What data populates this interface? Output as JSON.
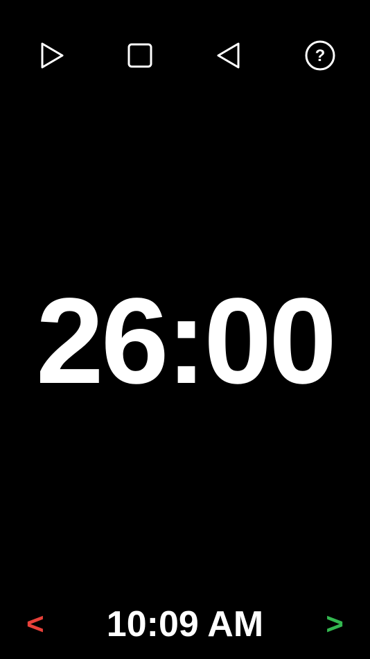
{
  "colors": {
    "background": "#000000",
    "foreground": "#ffffff",
    "prev_arrow": "#e8413a",
    "next_arrow": "#33b850"
  },
  "toolbar": {
    "play_icon": "play-icon",
    "stop_icon": "stop-icon",
    "back_icon": "back-triangle-icon",
    "help_icon": "help-icon",
    "help_glyph": "?"
  },
  "timer": {
    "display": "26:00"
  },
  "footer": {
    "prev_label": "<",
    "clock": "10:09 AM",
    "next_label": ">"
  }
}
